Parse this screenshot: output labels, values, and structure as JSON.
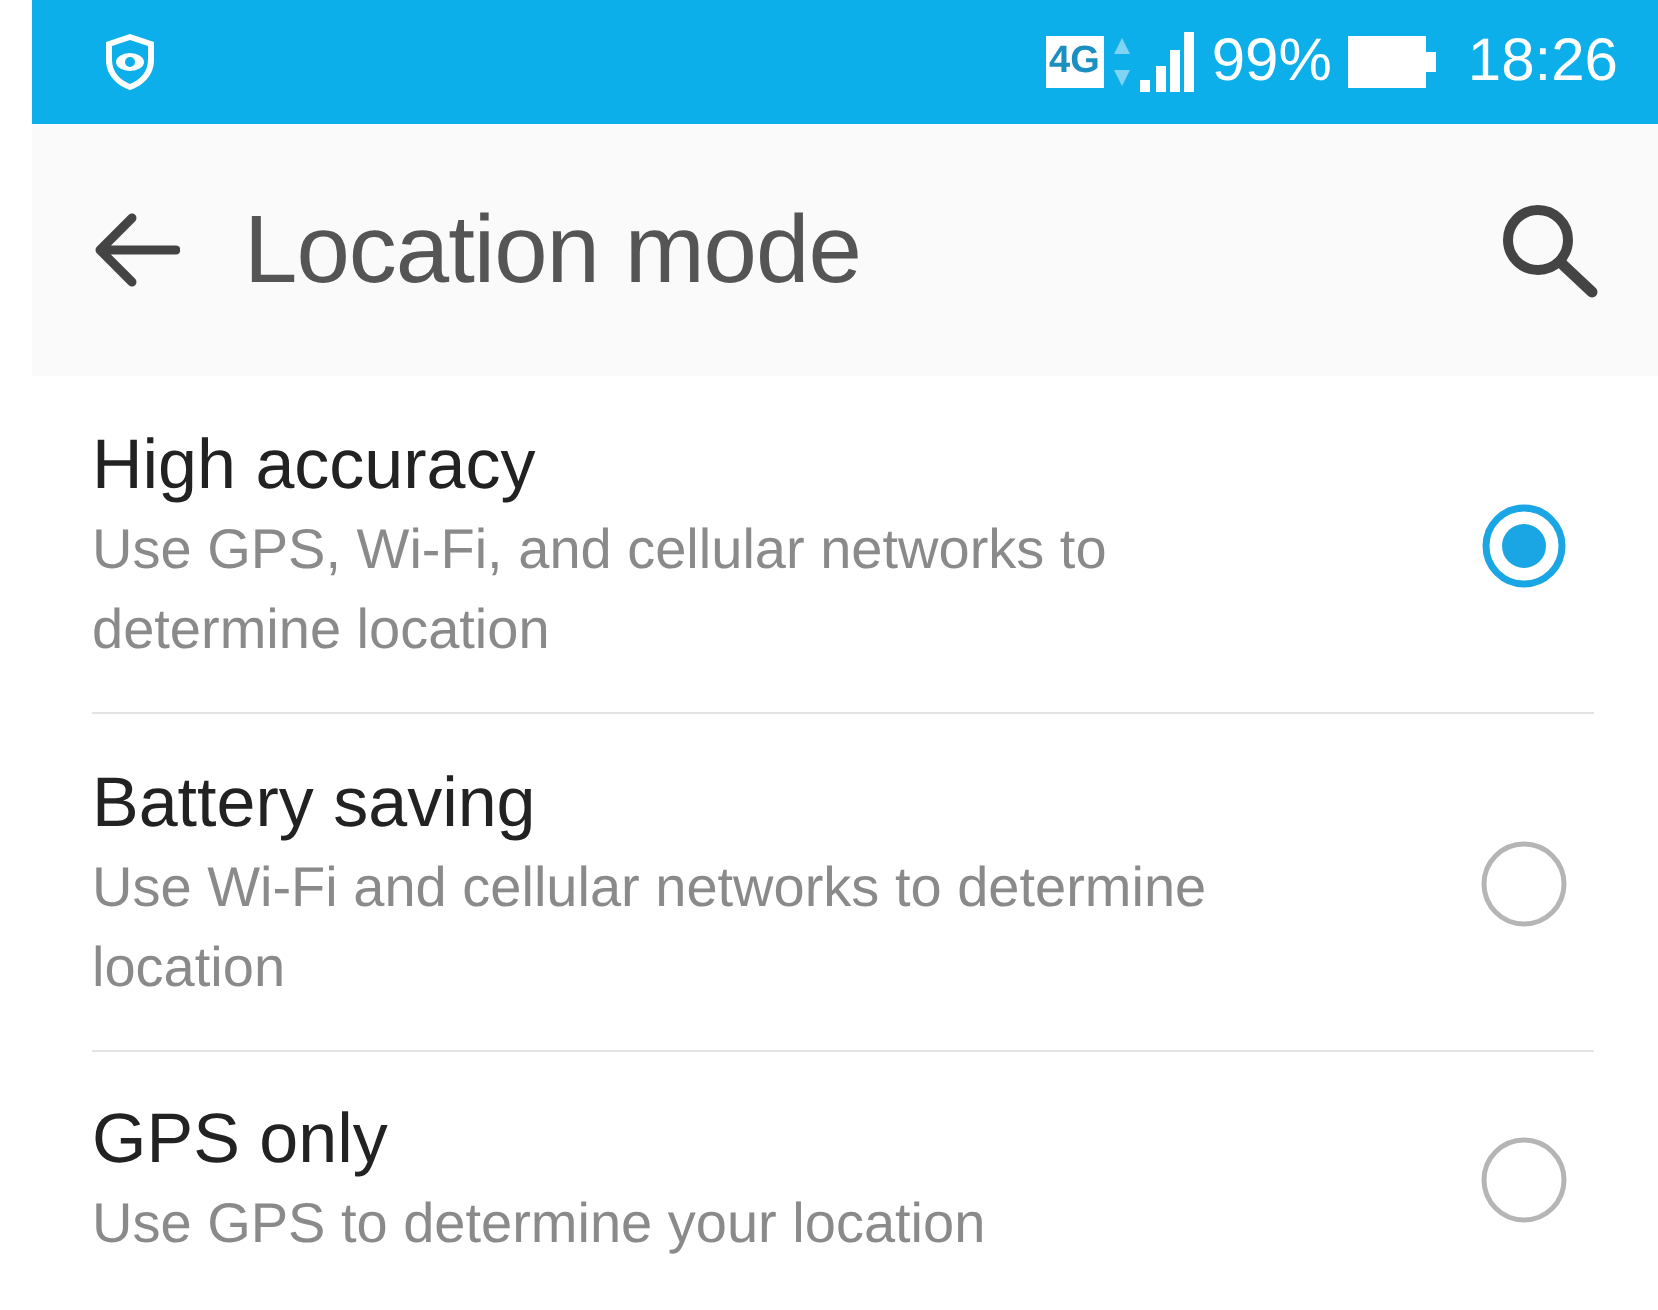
{
  "status_bar": {
    "network": "4G",
    "battery": "99%",
    "time": "18:26"
  },
  "toolbar": {
    "title": "Location mode"
  },
  "options": [
    {
      "title": "High accuracy",
      "description": "Use GPS, Wi-Fi, and cellular networks to determine location",
      "selected": true
    },
    {
      "title": "Battery saving",
      "description": "Use Wi-Fi and cellular networks to determine location",
      "selected": false
    },
    {
      "title": "GPS only",
      "description": "Use GPS to determine your location",
      "selected": false
    }
  ]
}
